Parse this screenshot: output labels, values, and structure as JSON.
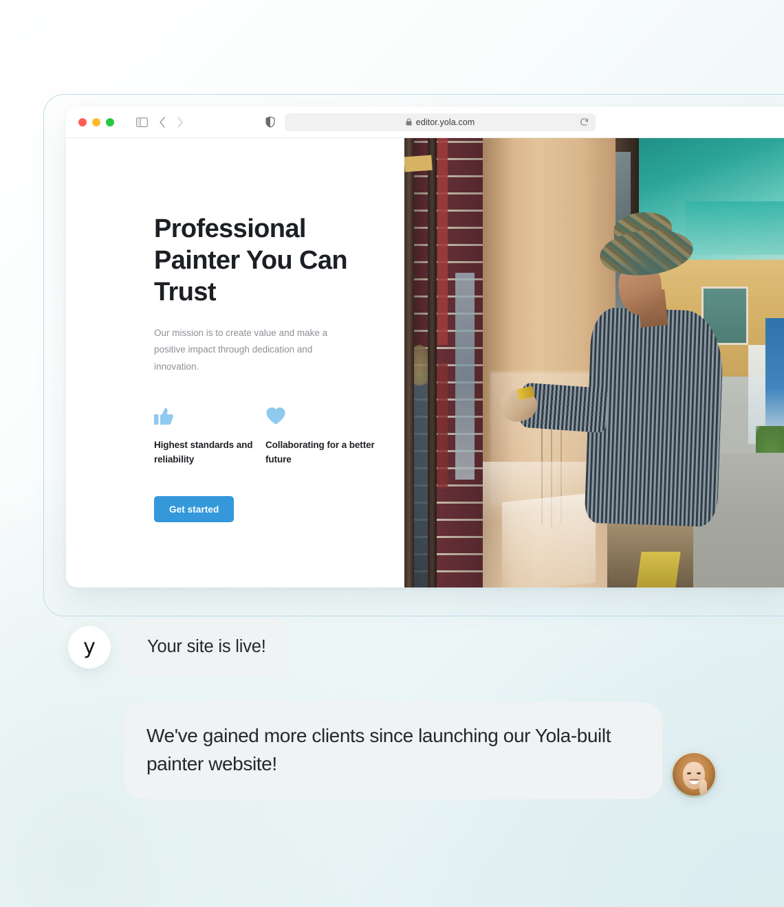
{
  "browser": {
    "traffic_lights": [
      {
        "name": "close",
        "color": "#ff5f57"
      },
      {
        "name": "minimize",
        "color": "#febc2e"
      },
      {
        "name": "maximize",
        "color": "#28c840"
      }
    ],
    "sidebar_icon": "sidebar-toggle-icon",
    "back_icon": "chevron-left-icon",
    "forward_icon": "chevron-right-icon",
    "shield_icon": "shield-privacy-icon",
    "lock_icon": "lock-icon",
    "url": "editor.yola.com",
    "reload_icon": "reload-icon"
  },
  "site": {
    "hero": {
      "title": "Professional Painter You Can Trust",
      "subtitle": "Our mission is to create value and make a positive impact through dedication and innovation.",
      "cta_label": "Get started",
      "cta_color": "#3498db"
    },
    "features": [
      {
        "icon": "thumbs-up-icon",
        "label": "Highest standards and reliability",
        "color": "#8fc9ee"
      },
      {
        "icon": "heart-icon",
        "label": "Collaborating for a better future",
        "color": "#8fc9ee"
      }
    ],
    "photo_alt": "painter-at-work-photo"
  },
  "chat": {
    "brand_initial": "y",
    "messages": [
      {
        "id": "status",
        "text": "Your site is live!"
      },
      {
        "id": "testimonial",
        "text": "We've gained more clients since launching our Yola-built painter website!"
      }
    ],
    "customer_avatar": "customer-avatar-photo"
  }
}
